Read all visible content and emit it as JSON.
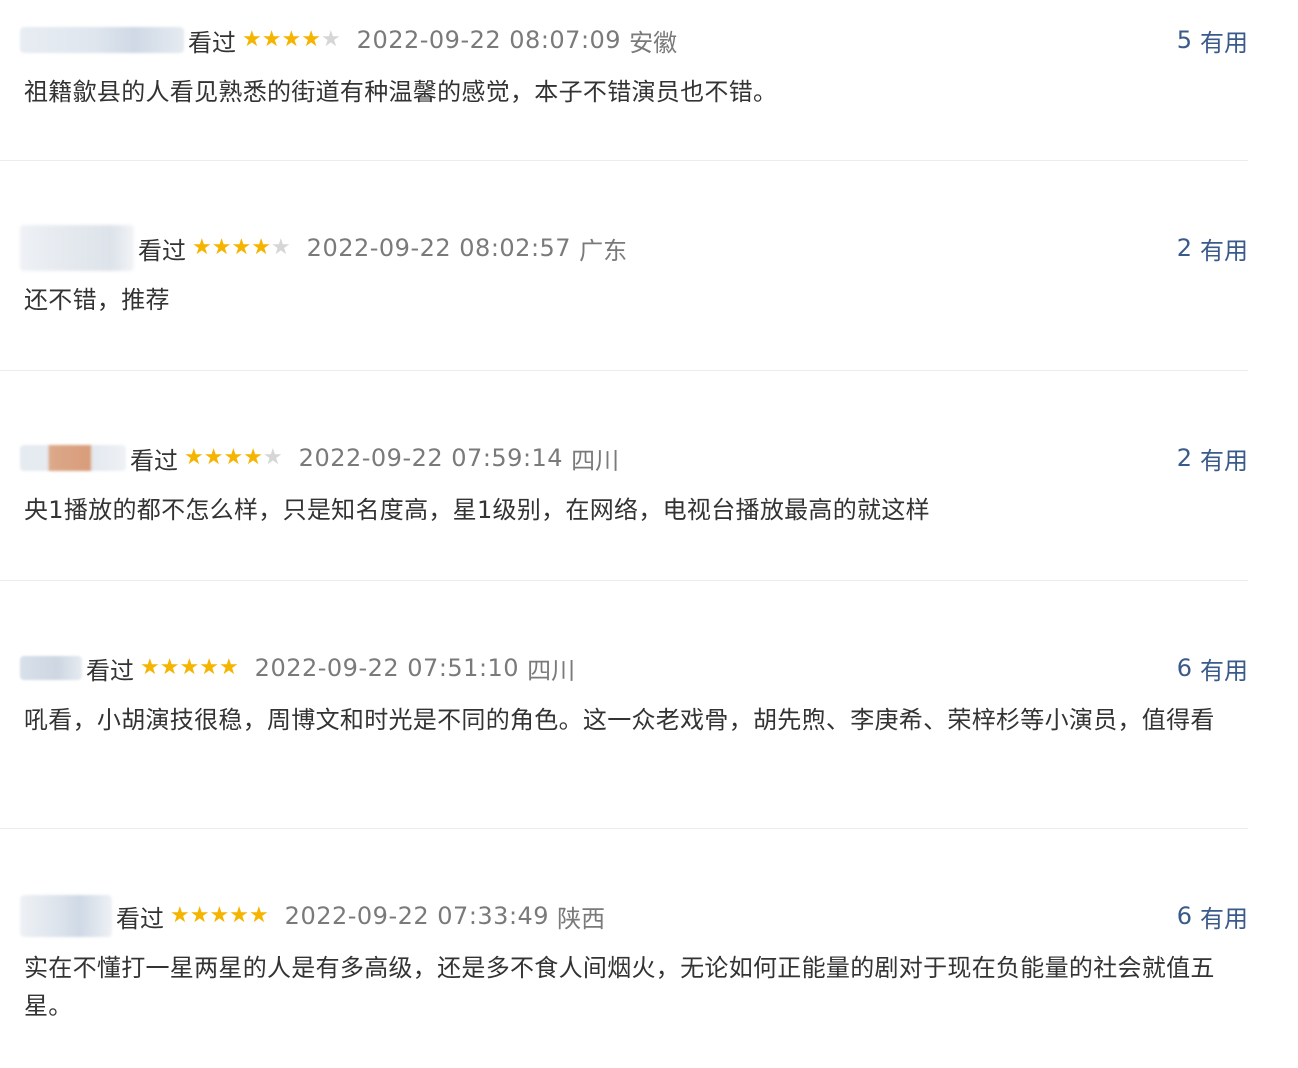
{
  "comments": [
    {
      "status": "看过",
      "rating": 4,
      "time": "2022-09-22 08:07:09",
      "location": "安徽",
      "useful_count": "5",
      "useful_label": "有用",
      "text": "祖籍歙县的人看见熟悉的街道有种温馨的感觉，本子不错演员也不错。"
    },
    {
      "status": "看过",
      "rating": 4,
      "time": "2022-09-22 08:02:57",
      "location": "广东",
      "useful_count": "2",
      "useful_label": "有用",
      "text": "还不错，推荐"
    },
    {
      "status": "看过",
      "rating": 4,
      "time": "2022-09-22 07:59:14",
      "location": "四川",
      "useful_count": "2",
      "useful_label": "有用",
      "text": "央1播放的都不怎么样，只是知名度高，星1级别，在网络，电视台播放最高的就这样"
    },
    {
      "status": "看过",
      "rating": 5,
      "time": "2022-09-22 07:51:10",
      "location": "四川",
      "useful_count": "6",
      "useful_label": "有用",
      "text": "吼看，小胡演技很稳，周博文和时光是不同的角色。这一众老戏骨，胡先煦、李庚希、荣梓杉等小演员，值得看"
    },
    {
      "status": "看过",
      "rating": 5,
      "time": "2022-09-22 07:33:49",
      "location": "陕西",
      "useful_count": "6",
      "useful_label": "有用",
      "text": "实在不懂打一星两星的人是有多高级，还是多不食人间烟火，无论如何正能量的剧对于现在负能量的社会就值五星。"
    }
  ],
  "colors": {
    "star_on": "#f5b400",
    "star_off": "#d6d6d6",
    "useful_link": "#3a5a8a",
    "meta_text": "#7a7a7a",
    "body_text": "#333333"
  },
  "icons": {
    "star": "star-icon"
  }
}
